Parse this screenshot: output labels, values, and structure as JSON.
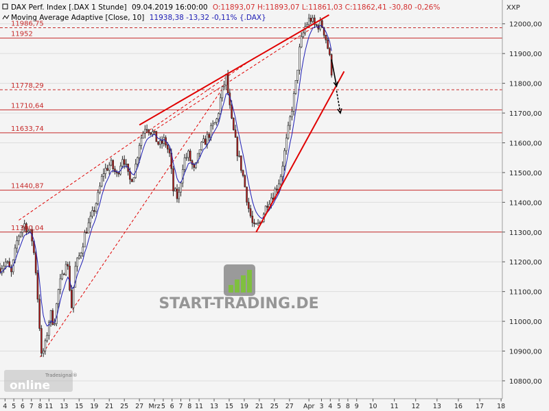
{
  "header": {
    "line1": {
      "name": "DAX Perf. Index [.DAX  1 Stunde]",
      "stamp": "09.04.2019 16:00:00",
      "ohlc": "O:11893,07 H:11893,07 L:11861,03 C:11862,41 -30,80 -0,26%"
    },
    "line2": {
      "name": "Moving Average Adaptive [Close, 10]",
      "value": "11938,38 -13,32 -0,11% {.DAX}"
    },
    "axis_unit": "XXP"
  },
  "watermark": {
    "brand": "START-TRADING.DE",
    "vendor_top": "Tradesignal®",
    "vendor_bottom": "online"
  },
  "colors": {
    "background": "#f4f4f4",
    "grid": "#dcdcdc",
    "level_line": "#c62828",
    "level_label": "#c62828",
    "trend_line": "#e00000",
    "ma_line": "#1c1cb4",
    "candle_up": "#ffffff",
    "candle_down": "#b71c1c",
    "header_name": "#000000",
    "header_value_ma": "#1c1cb4",
    "header_ohlc": "#d32f2f",
    "arrow": "#000000"
  },
  "chart_data": {
    "type": "candlestick",
    "title": "DAX Perf. Index [.DAX  1 Stunde]",
    "ylim": [
      10740,
      12080
    ],
    "y_ticks": [
      "10800,00",
      "10900,00",
      "11000,00",
      "11100,00",
      "11200,00",
      "11300,00",
      "11400,00",
      "11500,00",
      "11600,00",
      "11700,00",
      "11800,00",
      "11900,00",
      "12000,00"
    ],
    "y_tick_values": [
      10800,
      10900,
      11000,
      11100,
      11200,
      11300,
      11400,
      11500,
      11600,
      11700,
      11800,
      11900,
      12000
    ],
    "x_ticks": [
      {
        "label": "4",
        "i": 8
      },
      {
        "label": "5",
        "i": 22
      },
      {
        "label": "6",
        "i": 36
      },
      {
        "label": "7",
        "i": 50
      },
      {
        "label": "8",
        "i": 64
      },
      {
        "label": "11",
        "i": 78
      },
      {
        "label": "13",
        "i": 102
      },
      {
        "label": "15",
        "i": 126
      },
      {
        "label": "19",
        "i": 150
      },
      {
        "label": "21",
        "i": 174
      },
      {
        "label": "25",
        "i": 198
      },
      {
        "label": "27",
        "i": 222
      },
      {
        "label": "Mrz",
        "i": 246
      },
      {
        "label": "5",
        "i": 260
      },
      {
        "label": "6",
        "i": 274
      },
      {
        "label": "7",
        "i": 288
      },
      {
        "label": "8",
        "i": 302
      },
      {
        "label": "11",
        "i": 317
      },
      {
        "label": "13",
        "i": 341
      },
      {
        "label": "15",
        "i": 365
      },
      {
        "label": "19",
        "i": 389
      },
      {
        "label": "21",
        "i": 413
      },
      {
        "label": "25",
        "i": 437
      },
      {
        "label": "27",
        "i": 461
      },
      {
        "label": "Apr",
        "i": 492
      },
      {
        "label": "3",
        "i": 512
      },
      {
        "label": "4",
        "i": 526
      },
      {
        "label": "5",
        "i": 540
      },
      {
        "label": "8",
        "i": 554
      },
      {
        "label": "9",
        "i": 568
      },
      {
        "label": "10",
        "i": 594
      },
      {
        "label": "11",
        "i": 628
      },
      {
        "label": "12",
        "i": 662
      },
      {
        "label": "13",
        "i": 696
      },
      {
        "label": "16",
        "i": 730
      },
      {
        "label": "17",
        "i": 764
      },
      {
        "label": "18",
        "i": 798
      }
    ],
    "levels": [
      {
        "label": "11986,75",
        "value": 11986.75,
        "dashed": true
      },
      {
        "label": "11952",
        "value": 11952,
        "dashed": false
      },
      {
        "label": "11778,29",
        "value": 11778.29,
        "dashed": true
      },
      {
        "label": "11710,64",
        "value": 11710.64,
        "dashed": false
      },
      {
        "label": "11633,74",
        "value": 11633.74,
        "dashed": false
      },
      {
        "label": "11440,87",
        "value": 11440.87,
        "dashed": false
      },
      {
        "label": "11300,04",
        "value": 11300.04,
        "dashed": false
      }
    ],
    "path_points": [
      [
        0,
        11180
      ],
      [
        10,
        11200
      ],
      [
        18,
        11160
      ],
      [
        28,
        11280
      ],
      [
        38,
        11330
      ],
      [
        46,
        11300
      ],
      [
        50,
        11290
      ],
      [
        56,
        11200
      ],
      [
        62,
        11020
      ],
      [
        66,
        10880
      ],
      [
        72,
        10920
      ],
      [
        80,
        11030
      ],
      [
        86,
        10990
      ],
      [
        94,
        11120
      ],
      [
        100,
        11150
      ],
      [
        106,
        11220
      ],
      [
        114,
        11050
      ],
      [
        120,
        11180
      ],
      [
        128,
        11230
      ],
      [
        136,
        11300
      ],
      [
        146,
        11350
      ],
      [
        156,
        11420
      ],
      [
        164,
        11500
      ],
      [
        176,
        11530
      ],
      [
        186,
        11490
      ],
      [
        196,
        11560
      ],
      [
        206,
        11470
      ],
      [
        214,
        11500
      ],
      [
        222,
        11600
      ],
      [
        232,
        11660
      ],
      [
        244,
        11630
      ],
      [
        254,
        11590
      ],
      [
        262,
        11610
      ],
      [
        270,
        11560
      ],
      [
        276,
        11440
      ],
      [
        284,
        11410
      ],
      [
        292,
        11540
      ],
      [
        300,
        11560
      ],
      [
        310,
        11500
      ],
      [
        318,
        11580
      ],
      [
        328,
        11610
      ],
      [
        338,
        11650
      ],
      [
        346,
        11680
      ],
      [
        352,
        11760
      ],
      [
        360,
        11820
      ],
      [
        368,
        11680
      ],
      [
        378,
        11570
      ],
      [
        386,
        11500
      ],
      [
        396,
        11380
      ],
      [
        404,
        11310
      ],
      [
        414,
        11330
      ],
      [
        426,
        11400
      ],
      [
        436,
        11430
      ],
      [
        446,
        11480
      ],
      [
        454,
        11580
      ],
      [
        462,
        11680
      ],
      [
        470,
        11780
      ],
      [
        478,
        11930
      ],
      [
        486,
        11990
      ],
      [
        494,
        12020
      ],
      [
        502,
        11990
      ],
      [
        512,
        12000
      ],
      [
        518,
        11960
      ],
      [
        524,
        11900
      ],
      [
        528,
        11840
      ]
    ],
    "trend_lines": [
      {
        "p1": [
          222,
          11660
        ],
        "p2": [
          524,
          12030
        ],
        "width": 2,
        "dashed": false
      },
      {
        "p1": [
          408,
          11300
        ],
        "p2": [
          548,
          11840
        ],
        "width": 2,
        "dashed": false
      },
      {
        "p1": [
          30,
          11340
        ],
        "p2": [
          408,
          11890
        ],
        "width": 1,
        "dashed": true
      },
      {
        "p1": [
          64,
          10880
        ],
        "p2": [
          360,
          11800
        ],
        "width": 1,
        "dashed": true
      },
      {
        "p1": [
          244,
          11640
        ],
        "p2": [
          500,
          11990
        ],
        "width": 1,
        "dashed": true
      }
    ],
    "arrows": [
      {
        "from": [
          528,
          11880
        ],
        "to": [
          536,
          11790
        ],
        "dashed": false
      },
      {
        "from": [
          536,
          11775
        ],
        "to": [
          542,
          11700
        ],
        "dashed": true
      }
    ]
  }
}
